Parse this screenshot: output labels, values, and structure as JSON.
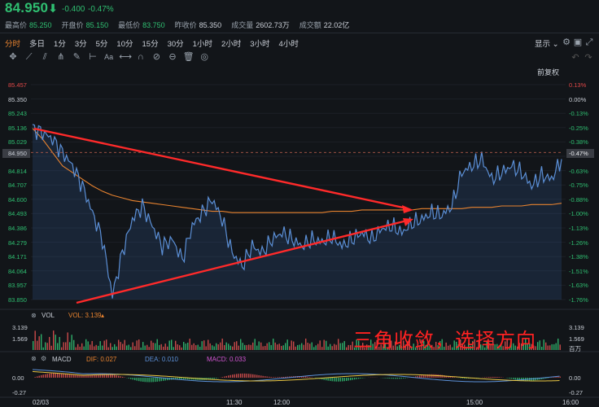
{
  "header": {
    "price": "84.950",
    "price_arrow": "⬇",
    "change": "-0.400",
    "change_pct": "-0.47%",
    "stats": [
      {
        "key": "最高价",
        "value": "85.250",
        "tone": "green"
      },
      {
        "key": "开盘价",
        "value": "85.150",
        "tone": "green"
      },
      {
        "key": "最低价",
        "value": "83.750",
        "tone": "green"
      },
      {
        "key": "昨收价",
        "value": "85.350",
        "tone": "plain"
      },
      {
        "key": "成交量",
        "value": "2602.73万",
        "tone": "plain"
      },
      {
        "key": "成交额",
        "value": "22.02亿",
        "tone": "plain"
      }
    ]
  },
  "timeframes": [
    "分时",
    "多日",
    "1分",
    "3分",
    "5分",
    "10分",
    "15分",
    "30分",
    "1小时",
    "2小时",
    "3小时",
    "4小时"
  ],
  "active_timeframe": "分时",
  "toolbar": {
    "display_label": "显示",
    "restore_label": "前复权",
    "tools": [
      "crosshair-icon",
      "trendline-icon",
      "channel-icon",
      "fork-icon",
      "brush-icon",
      "ruler-icon",
      "text-icon",
      "measure-icon",
      "magnet-icon",
      "hide-icon",
      "lock-icon",
      "trash-icon",
      "eye-icon"
    ]
  },
  "axes": {
    "price_ticks": [
      "85.457",
      "85.350",
      "85.243",
      "85.136",
      "85.029",
      "84.950",
      "84.814",
      "84.707",
      "84.600",
      "84.493",
      "84.386",
      "84.279",
      "84.171",
      "84.064",
      "83.957",
      "83.850"
    ],
    "pct_ticks": [
      "0.13%",
      "0.00%",
      "-0.13%",
      "-0.25%",
      "-0.38%",
      "-0.47%",
      "-0.63%",
      "-0.75%",
      "-0.88%",
      "-1.00%",
      "-1.13%",
      "-1.26%",
      "-1.38%",
      "-1.51%",
      "-1.63%",
      "-1.76%"
    ],
    "time_ticks": [
      "02/03",
      "11:30",
      "12:00",
      "15:00",
      "16:00"
    ]
  },
  "volume_pane": {
    "name": "VOL",
    "label": "VOL: 3.139",
    "ticks": [
      "3.139",
      "1.569"
    ],
    "right_ticks": [
      "3.139",
      "1.569",
      "百万"
    ]
  },
  "macd_pane": {
    "name": "MACD",
    "dif": "DIF: 0.027",
    "dea": "DEA: 0.010",
    "macd": "MACD: 0.033",
    "ticks": [
      "0.00",
      "-0.27"
    ],
    "right_ticks": [
      "0.00",
      "-0.27"
    ]
  },
  "annotation": "三角收敛，选择方向",
  "colors": {
    "up": "#e04848",
    "down": "#2fbf71",
    "price_line": "#5b8fd6",
    "avg_line": "#e8832f",
    "accent": "#e8832f"
  },
  "chart_data": {
    "type": "line",
    "series": [
      {
        "values": [
          85.13,
          85.1,
          85.05,
          84.95,
          84.85,
          84.7,
          84.5,
          84.3,
          83.88,
          84.2,
          84.45,
          84.55,
          84.4,
          84.25,
          84.3,
          84.15,
          84.4,
          84.5,
          84.6,
          84.45,
          84.2,
          84.1,
          84.25,
          84.2,
          84.3,
          84.35,
          84.3,
          84.25,
          84.3,
          84.28,
          84.32,
          84.25,
          84.3,
          84.35,
          84.3,
          84.38,
          84.4,
          84.35,
          84.42,
          84.45,
          84.5,
          84.48,
          84.55,
          84.8,
          84.85,
          84.9,
          84.75,
          84.8,
          84.85,
          84.8,
          84.7,
          84.78,
          84.75,
          84.9
        ]
      },
      {
        "values": [
          85.13,
          85.05,
          84.95,
          84.85,
          84.8,
          84.75,
          84.7,
          84.66,
          84.63,
          84.61,
          84.59,
          84.58,
          84.57,
          84.56,
          84.55,
          84.54,
          84.53,
          84.52,
          84.51,
          84.51,
          84.5,
          84.5,
          84.5,
          84.5,
          84.5,
          84.5,
          84.5,
          84.5,
          84.5,
          84.5,
          84.51,
          84.51,
          84.51,
          84.52,
          84.52,
          84.52,
          84.52,
          84.52,
          84.52,
          84.53,
          84.53,
          84.53,
          84.53,
          84.53,
          84.54,
          84.54,
          84.54,
          84.55,
          84.55,
          84.55,
          84.56,
          84.56,
          84.56,
          84.57
        ]
      }
    ],
    "ylim": [
      83.85,
      85.457
    ]
  }
}
